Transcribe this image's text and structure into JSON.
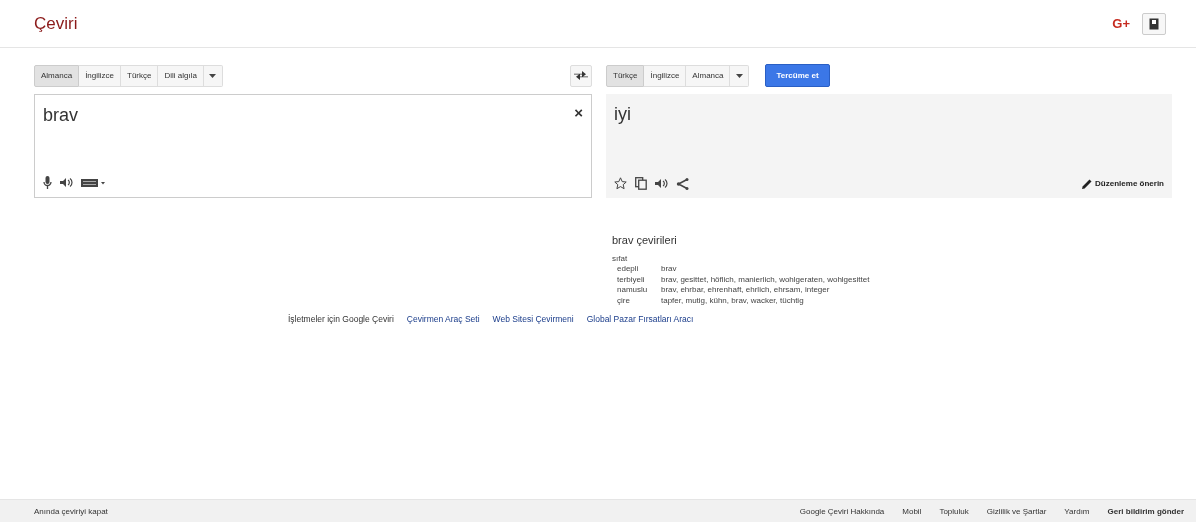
{
  "header": {
    "title": "Çeviri",
    "gplus": "G+"
  },
  "source": {
    "languages": [
      {
        "label": "Almanca",
        "selected": true
      },
      {
        "label": "İngilizce",
        "selected": false
      },
      {
        "label": "Türkçe",
        "selected": false
      },
      {
        "label": "Dili algıla",
        "selected": false
      }
    ],
    "text": "brav",
    "clear": "×"
  },
  "target": {
    "languages": [
      {
        "label": "Türkçe",
        "selected": true
      },
      {
        "label": "İngilizce",
        "selected": false
      },
      {
        "label": "Almanca",
        "selected": false
      }
    ],
    "translate_button": "Tercüme et",
    "text": "iyi",
    "suggest_edit": "Düzenleme önerin"
  },
  "dictionary": {
    "title": "brav çevirileri",
    "part_of_speech": "sıfat",
    "entries": [
      {
        "word": "edepli",
        "translations": "brav"
      },
      {
        "word": "terbiyeli",
        "translations": "brav, gesittet, höflich, manierlich, wohlgeraten, wohlgesittet"
      },
      {
        "word": "namuslu",
        "translations": "brav, ehrbar, ehrenhaft, ehrlich, ehrsam, integer"
      },
      {
        "word": "çire",
        "translations": "tapfer, mutig, kühn, brav, wacker, tüchtig"
      }
    ]
  },
  "links": [
    {
      "label": "İşletmeler için Google Çeviri",
      "kind": "plain"
    },
    {
      "label": "Çevirmen Araç Seti",
      "kind": "link"
    },
    {
      "label": "Web Sitesi Çevirmeni",
      "kind": "link"
    },
    {
      "label": "Global Pazar Fırsatları Aracı",
      "kind": "link"
    }
  ],
  "footer": {
    "left": "Anında çeviriyi kapat",
    "links": [
      {
        "label": "Google Çeviri Hakkında",
        "bold": false
      },
      {
        "label": "Mobil",
        "bold": false
      },
      {
        "label": "Topluluk",
        "bold": false
      },
      {
        "label": "Gizlilik ve Şartlar",
        "bold": false
      },
      {
        "label": "Yardım",
        "bold": false
      },
      {
        "label": "Geri bildirim gönder",
        "bold": true
      }
    ]
  }
}
